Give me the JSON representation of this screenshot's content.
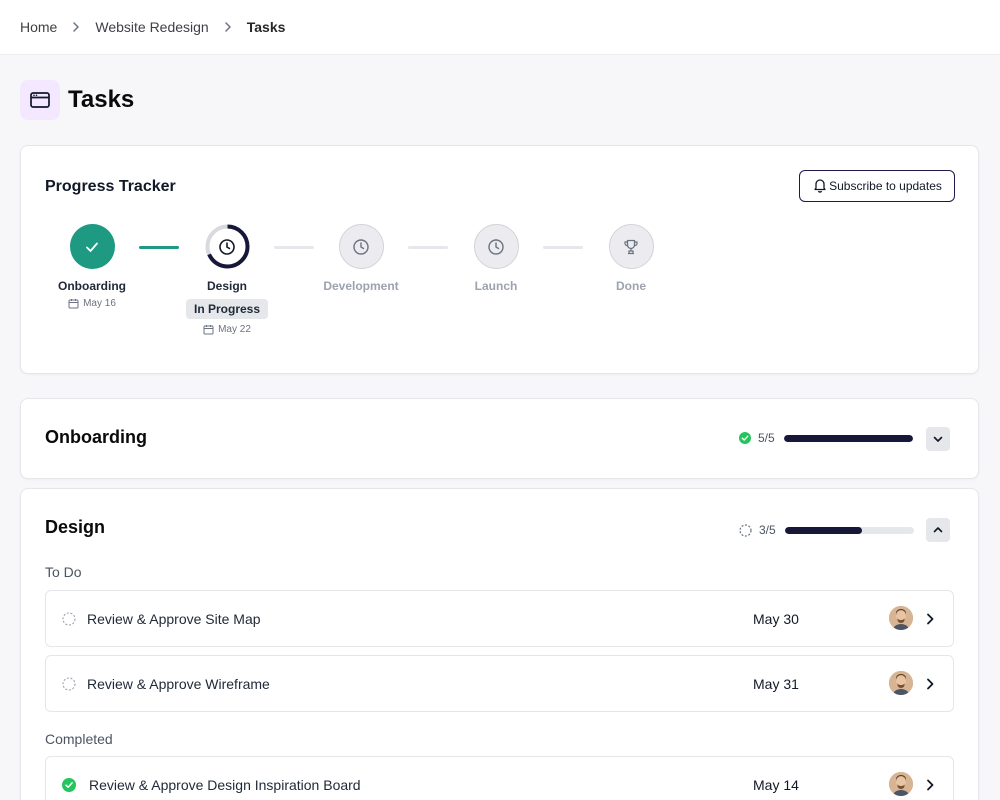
{
  "breadcrumb": {
    "items": [
      {
        "label": "Home"
      },
      {
        "label": "Website Redesign"
      },
      {
        "label": "Tasks"
      }
    ]
  },
  "page": {
    "title": "Tasks",
    "icon": "browser-window-icon",
    "icon_bg": "#f3e8ff"
  },
  "tracker": {
    "title": "Progress Tracker",
    "subscribe_label": "Subscribe to updates",
    "subscribe_icon": "bell-icon",
    "steps": [
      {
        "label": "Onboarding",
        "status": "done",
        "date": "May 16",
        "icon": "check-icon"
      },
      {
        "label": "Design",
        "status": "in-progress",
        "badge": "In Progress",
        "date": "May 22",
        "icon": "clock-icon"
      },
      {
        "label": "Development",
        "status": "pending",
        "icon": "clock-icon"
      },
      {
        "label": "Launch",
        "status": "pending",
        "icon": "clock-icon"
      },
      {
        "label": "Done",
        "status": "pending",
        "icon": "trophy-icon"
      }
    ]
  },
  "sections": {
    "onboarding": {
      "title": "Onboarding",
      "count": "5/5",
      "progress_fraction": 1.0,
      "status_icon": "check-circle-icon",
      "expanded": false
    },
    "design": {
      "title": "Design",
      "count": "3/5",
      "progress_fraction": 0.6,
      "status_icon": "dashed-circle-icon",
      "expanded": true,
      "todo_label": "To Do",
      "completed_label": "Completed",
      "todo": [
        {
          "title": "Review & Approve Site Map",
          "date": "May 30"
        },
        {
          "title": "Review & Approve Wireframe",
          "date": "May 31"
        }
      ],
      "completed": [
        {
          "title": "Review & Approve Design Inspiration Board",
          "date": "May 14"
        }
      ]
    }
  },
  "colors": {
    "accent_green": "#1f9a82",
    "check_green": "#22c55e",
    "navy": "#17173a",
    "page_bg": "#f7f7fa"
  }
}
